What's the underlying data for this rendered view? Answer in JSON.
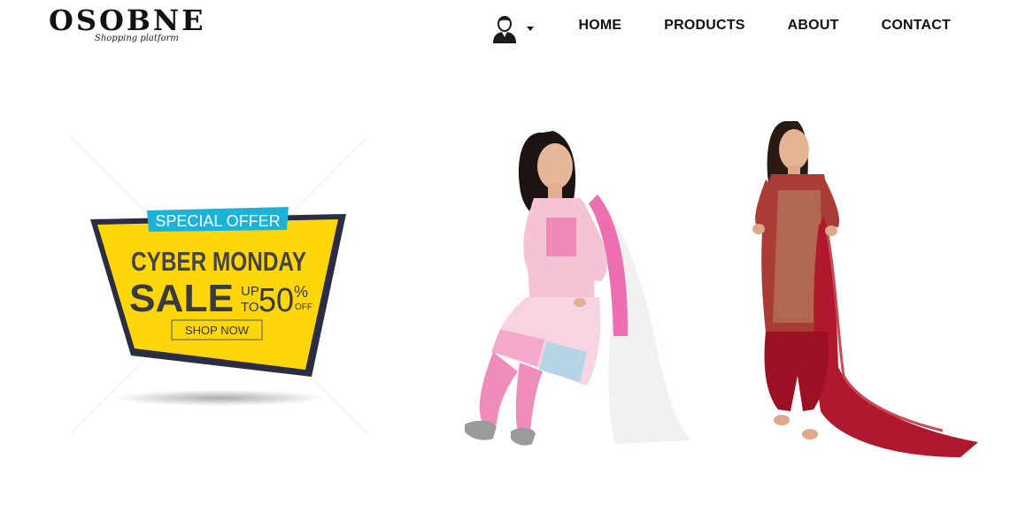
{
  "brand": {
    "name": "OSOBNE",
    "tagline": "Shopping platform"
  },
  "header": {
    "user_icon": "user-avatar-icon",
    "nav": [
      {
        "label": "HOME"
      },
      {
        "label": "PRODUCTS"
      },
      {
        "label": "ABOUT"
      },
      {
        "label": "CONTACT"
      }
    ]
  },
  "banner": {
    "tag": "SPECIAL OFFER",
    "headline": "CYBER MONDAY",
    "sale": "SALE",
    "upto_line1": "UP",
    "upto_line2": "TO",
    "discount": "50",
    "percent": "%",
    "off": "OFF",
    "cta": "SHOP NOW",
    "colors": {
      "yellow": "#FFD60A",
      "cyan": "#1CB3D6",
      "dark": "#2B2D42",
      "text": "#333333"
    }
  },
  "products": [
    {
      "name": "pink-salwar-suit",
      "color": "#F28CB8"
    },
    {
      "name": "red-patiala-suit",
      "color": "#B0182E"
    }
  ]
}
